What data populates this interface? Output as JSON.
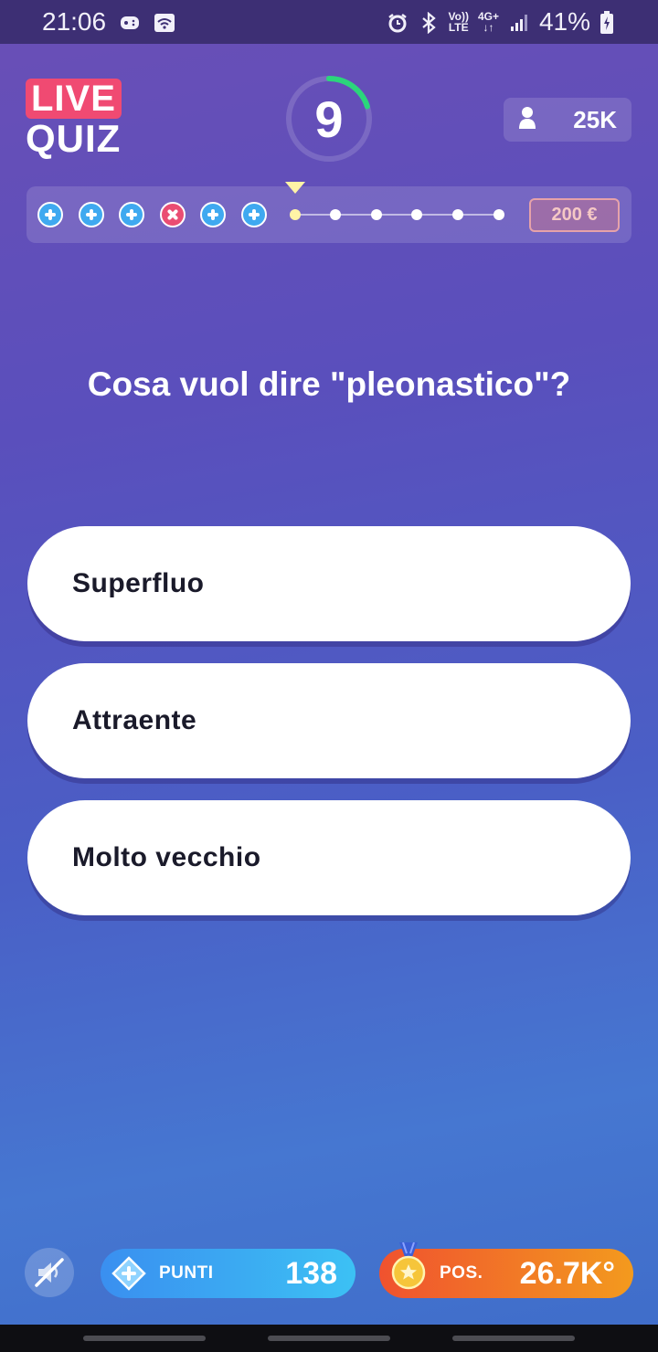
{
  "status_bar": {
    "time": "21:06",
    "volte": "Vo))",
    "lte": "LTE",
    "network": "4G+",
    "battery": "41%",
    "icons": [
      "gamepad-icon",
      "wifi-icon",
      "alarm-icon",
      "bluetooth-icon",
      "signal-icon",
      "battery-charging-icon"
    ]
  },
  "header": {
    "logo_live": "LIVE",
    "logo_quiz": "QUIZ",
    "timer_value": "9",
    "timer_fraction": 0.2,
    "viewers_icon": "user-icon",
    "viewers_count": "25K"
  },
  "progress": {
    "steps": [
      "correct",
      "correct",
      "correct",
      "wrong",
      "correct",
      "correct",
      "current",
      "pending",
      "pending",
      "pending",
      "pending",
      "pending"
    ],
    "prize": "200 €"
  },
  "question": {
    "text": "Cosa vuol dire \"pleonastico\"?"
  },
  "answers": [
    {
      "label": "Superfluo"
    },
    {
      "label": "Attraente"
    },
    {
      "label": "Molto vecchio"
    }
  ],
  "bottom": {
    "mute_icon": "speaker-muted-icon",
    "points_label": "PUNTI",
    "points_value": "138",
    "position_label": "POS.",
    "position_value": "26.7K°"
  },
  "colors": {
    "live_red": "#f04a72",
    "timer_green": "#2bd67b",
    "points_blue": "#3a8ff0",
    "position_orange": "#f0522f"
  }
}
